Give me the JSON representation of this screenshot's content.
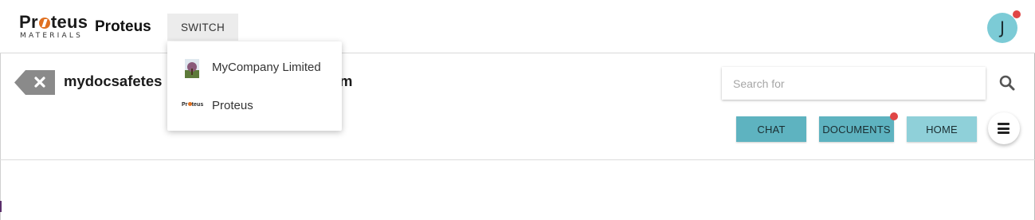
{
  "header": {
    "logo_word_start": "Pr",
    "logo_word_end": "teus",
    "logo_subtitle": "MATERIALS",
    "brand_name": "Proteus",
    "switch_label": "SWITCH",
    "avatar_initial": "J"
  },
  "switch_menu": {
    "items": [
      {
        "label": "MyCompany Limited",
        "icon": "company-thumbnail"
      },
      {
        "label": "Proteus",
        "icon": "proteus-logo-thumbnail"
      }
    ]
  },
  "page": {
    "title_visible_start": "mydocsafetes",
    "title_visible_end": "m"
  },
  "search": {
    "placeholder": "Search for"
  },
  "nav": {
    "chat": "CHAT",
    "documents": "DOCUMENTS",
    "home": "HOME"
  },
  "colors": {
    "accent": "#5eb3c0",
    "accent_light": "#8fd0d9",
    "notification": "#e04646",
    "logo_orange": "#e07020"
  }
}
